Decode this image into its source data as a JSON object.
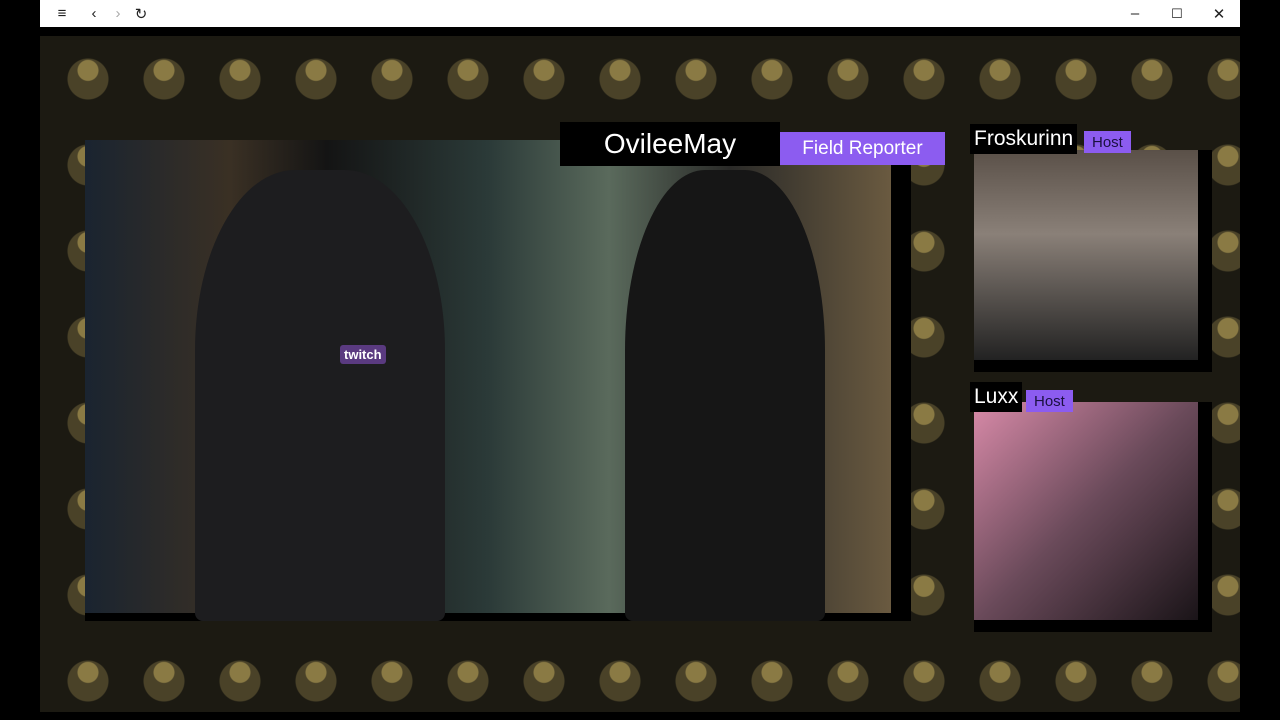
{
  "browser": {
    "menu_icon": "hamburger-icon",
    "back_icon": "chevron-left-icon",
    "forward_icon": "chevron-right-icon",
    "reload_icon": "reload-icon",
    "min_icon": "minimize-icon",
    "max_icon": "maximize-icon",
    "close_icon": "close-icon"
  },
  "stream": {
    "main": {
      "name": "OvileeMay",
      "role": "Field Reporter",
      "mic_label": "twitch"
    },
    "cams": [
      {
        "name": "Froskurinn",
        "badge": "Host"
      },
      {
        "name": "Luxx",
        "badge": "Host"
      }
    ],
    "colors": {
      "accent": "#8c5cf0"
    }
  }
}
